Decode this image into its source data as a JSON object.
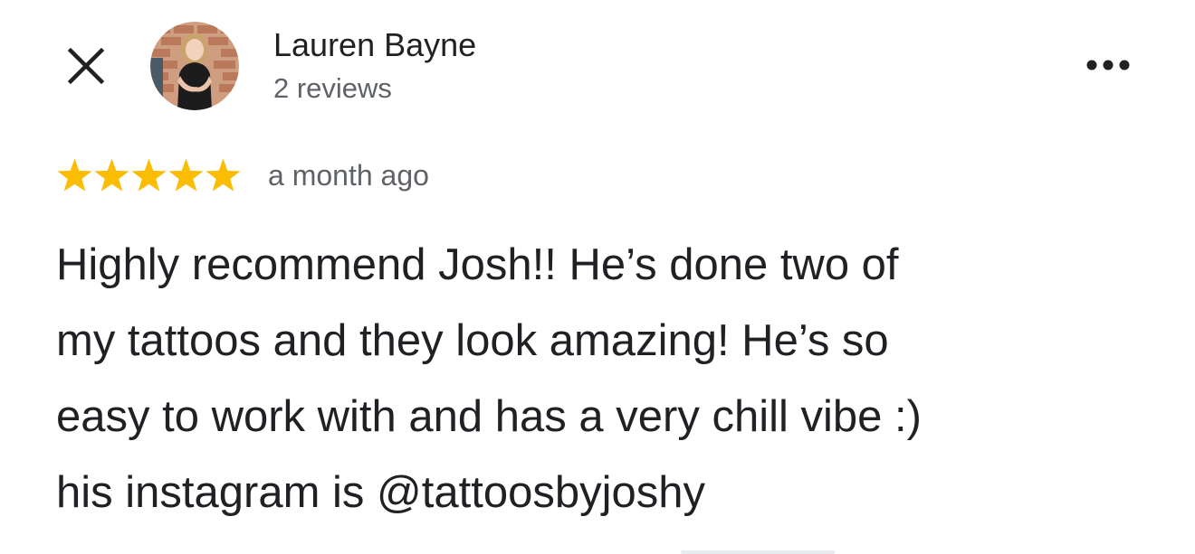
{
  "header": {
    "close_icon": "close-icon",
    "more_icon": "more-horizontal-icon",
    "author": {
      "name": "Lauren Bayne",
      "reviews": "2 reviews",
      "avatar_icon": "avatar-photo"
    }
  },
  "review": {
    "rating": 5,
    "rating_max": 5,
    "star_color": "#FBBC04",
    "time_ago": "a month ago",
    "lines": [
      "Highly recommend Josh!! He’s done two of",
      "my tattoos and they look amazing! He’s so",
      "easy to work with and has a very chill vibe :)",
      "his instagram is @tattoosbyjoshy"
    ]
  }
}
